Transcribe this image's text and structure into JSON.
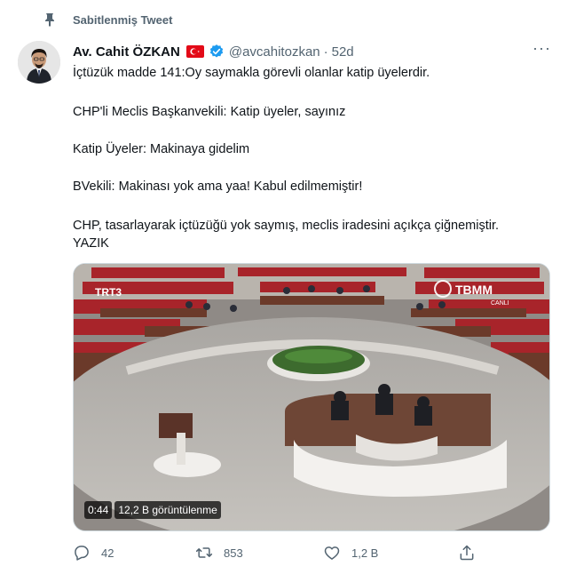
{
  "pinned": {
    "label": "Sabitlenmiş Tweet",
    "icon": "pin-icon"
  },
  "tweet": {
    "author_name": "Av. Cahit ÖZKAN",
    "handle": "@avcahitozkan",
    "separator": "·",
    "time": "52d",
    "flag_icon": "turkey-flag-icon",
    "verified_icon": "verified-badge-icon",
    "more_icon": "more-options-icon",
    "more_glyph": "···",
    "text": {
      "line1": "İçtüzük madde 141:Oy saymakla görevli olanlar katip üyelerdir.",
      "line2": "CHP'li Meclis Başkanvekili: Katip üyeler, sayınız",
      "line3": "Katip Üyeler: Makinaya gidelim",
      "line4": "BVekili: Makinası yok ama yaa! Kabul edilmemiştir!",
      "line5a": "CHP, tasarlayarak içtüzüğü yok saymış, meclis iradesini açıkça çiğnemiştir.",
      "line5b": "YAZIK"
    }
  },
  "video": {
    "channel_logo": "TRT3",
    "watermark": "TBMM",
    "watermark_sub": "CANLI",
    "duration": "0:44",
    "views": "12,2 B görüntülenme"
  },
  "actions": {
    "reply_count": "42",
    "retweet_count": "853",
    "like_count": "1,2 B",
    "reply_icon": "reply-icon",
    "retweet_icon": "retweet-icon",
    "like_icon": "heart-icon",
    "share_icon": "share-icon"
  },
  "colors": {
    "text": "#0f1419",
    "secondary": "#536471",
    "verified": "#1d9bf0",
    "flag": "#e30a17"
  }
}
